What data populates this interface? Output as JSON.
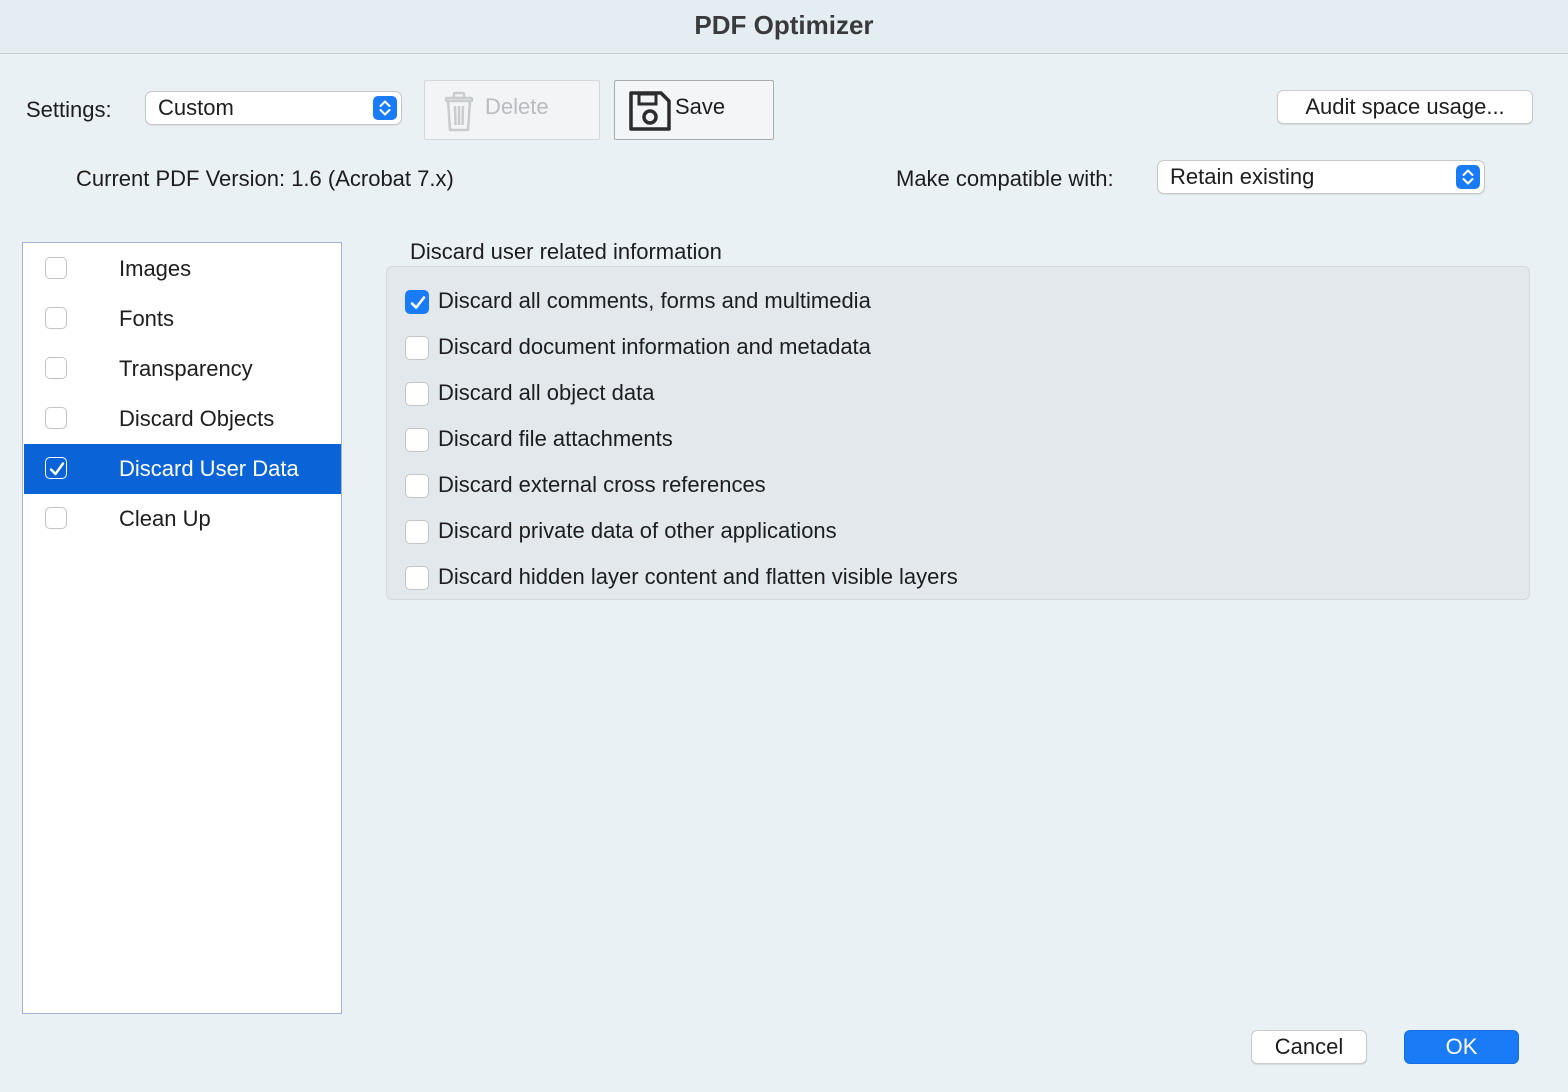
{
  "window": {
    "title": "PDF Optimizer"
  },
  "settings": {
    "label": "Settings:",
    "value": "Custom"
  },
  "toolbar": {
    "delete_label": "Delete",
    "save_label": "Save",
    "audit_label": "Audit space usage..."
  },
  "version": {
    "current_label": "Current PDF Version: 1.6 (Acrobat 7.x)",
    "compat_label": "Make compatible with:",
    "compat_value": "Retain existing"
  },
  "sidebar": {
    "items": [
      {
        "label": "Images",
        "checked": false,
        "selected": false
      },
      {
        "label": "Fonts",
        "checked": false,
        "selected": false
      },
      {
        "label": "Transparency",
        "checked": false,
        "selected": false
      },
      {
        "label": "Discard Objects",
        "checked": false,
        "selected": false
      },
      {
        "label": "Discard User Data",
        "checked": true,
        "selected": true
      },
      {
        "label": "Clean Up",
        "checked": false,
        "selected": false
      }
    ]
  },
  "panel": {
    "title": "Discard user related information",
    "options": [
      {
        "label": "Discard all comments, forms and multimedia",
        "checked": true
      },
      {
        "label": "Discard document information and metadata",
        "checked": false
      },
      {
        "label": "Discard all object data",
        "checked": false
      },
      {
        "label": "Discard file attachments",
        "checked": false
      },
      {
        "label": "Discard external cross references",
        "checked": false
      },
      {
        "label": "Discard private data of other applications",
        "checked": false
      },
      {
        "label": "Discard hidden layer content and flatten visible layers",
        "checked": false
      }
    ]
  },
  "footer": {
    "cancel_label": "Cancel",
    "ok_label": "OK"
  },
  "colors": {
    "accent": "#1a7bf6",
    "selection": "#0a64d8",
    "background": "#eaf1f4"
  }
}
